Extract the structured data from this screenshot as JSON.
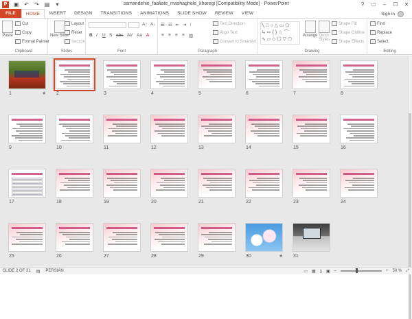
{
  "window": {
    "title": "samandehie_faaliate_mashaghele_kharegi [Compatibility Mode] - PowerPoint",
    "controls": [
      "?",
      "▭",
      "–",
      "☐",
      "✕"
    ]
  },
  "tabs": [
    {
      "label": "FILE"
    },
    {
      "label": "HOME"
    },
    {
      "label": "INSERT"
    },
    {
      "label": "DESIGN"
    },
    {
      "label": "TRANSITIONS"
    },
    {
      "label": "ANIMATIONS"
    },
    {
      "label": "SLIDE SHOW"
    },
    {
      "label": "REVIEW"
    },
    {
      "label": "VIEW"
    }
  ],
  "signin": "Sign in",
  "ribbon": {
    "clipboard": {
      "label": "Clipboard",
      "paste": "Paste",
      "cut": "Cut",
      "copy": "Copy",
      "format_painter": "Format Painter"
    },
    "slides": {
      "label": "Slides",
      "new_slide": "New Slide",
      "layout": "Layout",
      "reset": "Reset",
      "section": "Section"
    },
    "font": {
      "label": "Font"
    },
    "paragraph": {
      "label": "Paragraph",
      "text_direction": "Text Direction",
      "align_text": "Align Text",
      "convert_smartart": "Convert to SmartArt"
    },
    "drawing": {
      "label": "Drawing",
      "arrange": "Arrange",
      "quick_styles": "Quick Styles",
      "shape_fill": "Shape Fill",
      "shape_outline": "Shape Outline",
      "shape_effects": "Shape Effects"
    },
    "editing": {
      "label": "Editing",
      "find": "Find",
      "replace": "Replace",
      "select": "Select"
    }
  },
  "slides": [
    {
      "num": "1",
      "style": "photo-flowers",
      "star": true
    },
    {
      "num": "2",
      "style": "text",
      "selected": true
    },
    {
      "num": "3",
      "style": "text"
    },
    {
      "num": "4",
      "style": "text"
    },
    {
      "num": "5",
      "style": "pink"
    },
    {
      "num": "6",
      "style": "text"
    },
    {
      "num": "7",
      "style": "pink"
    },
    {
      "num": "8",
      "style": "text"
    },
    {
      "num": "9",
      "style": "text"
    },
    {
      "num": "10",
      "style": "text"
    },
    {
      "num": "11",
      "style": "pink"
    },
    {
      "num": "12",
      "style": "pink"
    },
    {
      "num": "13",
      "style": "pink"
    },
    {
      "num": "14",
      "style": "pink"
    },
    {
      "num": "15",
      "style": "pink"
    },
    {
      "num": "16",
      "style": "text"
    },
    {
      "num": "17",
      "style": "table"
    },
    {
      "num": "18",
      "style": "pink"
    },
    {
      "num": "19",
      "style": "pink"
    },
    {
      "num": "20",
      "style": "pink"
    },
    {
      "num": "21",
      "style": "pink"
    },
    {
      "num": "22",
      "style": "pink"
    },
    {
      "num": "23",
      "style": "pink"
    },
    {
      "num": "24",
      "style": "pink"
    },
    {
      "num": "25",
      "style": "pink"
    },
    {
      "num": "26",
      "style": "pink"
    },
    {
      "num": "27",
      "style": "pink"
    },
    {
      "num": "28",
      "style": "pink"
    },
    {
      "num": "29",
      "style": "pink"
    },
    {
      "num": "30",
      "style": "photo-sky",
      "star": true
    },
    {
      "num": "31",
      "style": "photo-laptop"
    }
  ],
  "status": {
    "slide": "SLIDE 2 OF 31",
    "language": "PERSIAN",
    "zoom": "50 %"
  }
}
